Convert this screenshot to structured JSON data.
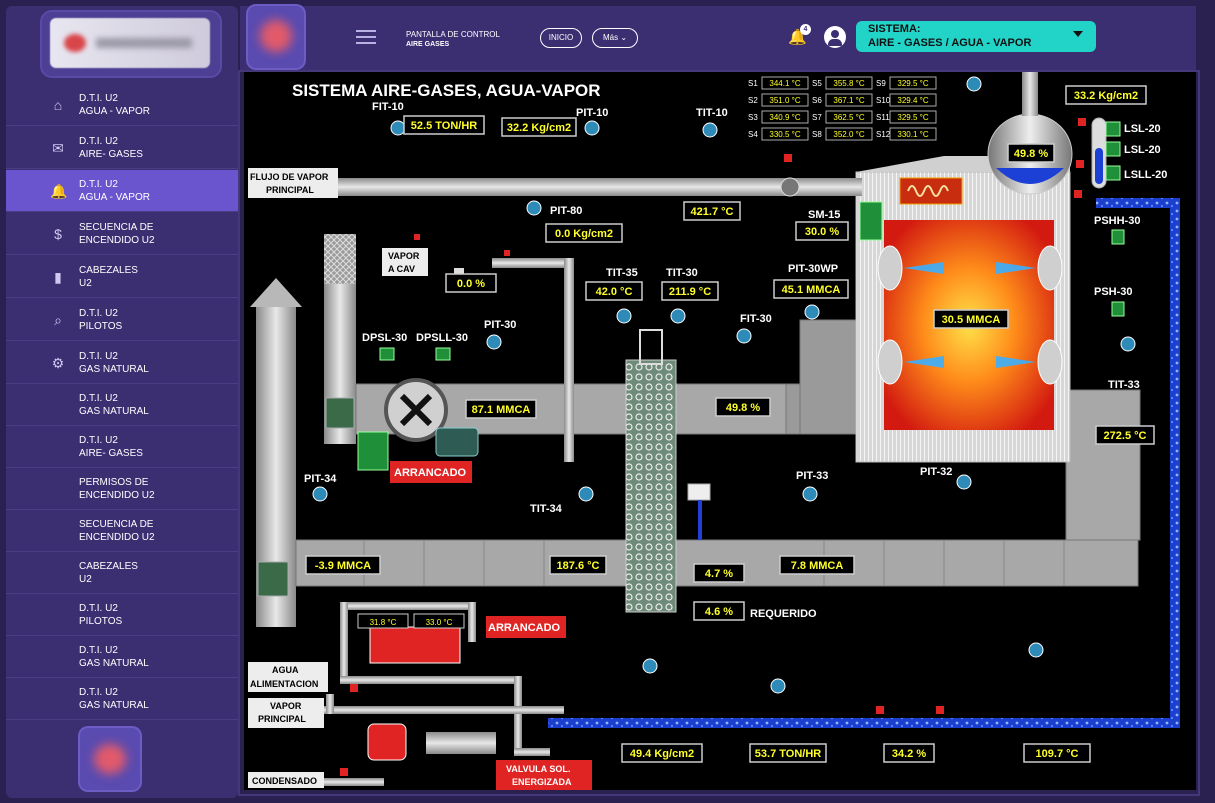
{
  "sidebar": {
    "items": [
      {
        "icon": "bank-icon",
        "l1": "D.T.I. U2",
        "l2": "AGUA - VAPOR"
      },
      {
        "icon": "mail-icon",
        "l1": "D.T.I. U2",
        "l2": "AIRE- GASES"
      },
      {
        "icon": "bell-icon",
        "l1": "D.T.I. U2",
        "l2": "AGUA - VAPOR"
      },
      {
        "icon": "dollar-icon",
        "l1": "SECUENCIA DE",
        "l2": "ENCENDIDO U2"
      },
      {
        "icon": "chart-icon",
        "l1": "CABEZALES",
        "l2": "U2"
      },
      {
        "icon": "search-icon",
        "l1": "D.T.I. U2",
        "l2": "PILOTOS"
      },
      {
        "icon": "gear-icon",
        "l1": "D.T.I. U2",
        "l2": "GAS NATURAL"
      },
      {
        "icon": "",
        "l1": "D.T.I. U2",
        "l2": "GAS NATURAL"
      },
      {
        "icon": "",
        "l1": "D.T.I. U2",
        "l2": "AIRE- GASES"
      },
      {
        "icon": "",
        "l1": "PERMISOS DE",
        "l2": "ENCENDIDO U2"
      },
      {
        "icon": "",
        "l1": "SECUENCIA DE",
        "l2": "ENCENDIDO U2"
      },
      {
        "icon": "",
        "l1": "CABEZALES",
        "l2": "U2"
      },
      {
        "icon": "",
        "l1": "D.T.I. U2",
        "l2": "PILOTOS"
      },
      {
        "icon": "",
        "l1": "D.T.I. U2",
        "l2": "GAS NATURAL"
      },
      {
        "icon": "",
        "l1": "D.T.I. U2",
        "l2": "GAS NATURAL"
      }
    ]
  },
  "topbar": {
    "title1": "PANTALLA DE CONTROL",
    "title2": "AIRE GASES",
    "inicio": "INICIO",
    "mas": "Más",
    "notifications": "4",
    "system_label": "SISTEMA:",
    "system_value": "AIRE - GASES / AGUA - VAPOR"
  },
  "scada": {
    "title": "SISTEMA  AIRE-GASES, AGUA-VAPOR",
    "tags": {
      "fit10": "FIT-10",
      "pit10": "PIT-10",
      "tit10": "TIT-10",
      "pit80": "PIT-80",
      "sm15": "SM-15",
      "tit35": "TIT-35",
      "tit30": "TIT-30",
      "pit30wp": "PIT-30WP",
      "fit30": "FIT-30",
      "pit30": "PIT-30",
      "dpsl30": "DPSL-30",
      "dpsll30": "DPSLL-30",
      "pit34": "PIT-34",
      "tit34": "TIT-34",
      "pit33": "PIT-33",
      "pit32": "PIT-32",
      "tit33": "TIT-33",
      "psh30": "PSH-30",
      "pshh30": "PSHH-30",
      "lsl20a": "LSL-20",
      "lsl20b": "LSL-20",
      "lsll20": "LSLL-20"
    },
    "labels": {
      "flujo1": "FLUJO DE VAPOR",
      "flujo2": "PRINCIPAL",
      "vapor_cav1": "VAPOR",
      "vapor_cav2": "A CAV",
      "agua1": "AGUA",
      "agua2": "ALIMENTACION",
      "vapor_p1": "VAPOR",
      "vapor_p2": "PRINCIPAL",
      "condensado": "CONDENSADO",
      "requerido": "REQUERIDO",
      "arrancado1": "ARRANCADO",
      "arrancado2": "ARRANCADO",
      "valvula1": "VALVULA SOL.",
      "valvula2": "ENERGIZADA"
    },
    "values": {
      "fit10": "52.5 TON/HR",
      "pit10": "32.2 Kg/cm2",
      "tit10": "421.7 °C",
      "pit80": "0.0 Kg/cm2",
      "sm15": "30.0 %",
      "vapor_cav": "0.0 %",
      "tit35": "42.0 °C",
      "tit30": "211.9 °C",
      "pit30wp": "45.1 MMCA",
      "furnace": "30.5 MMCA",
      "pit30": "87.1 MMCA",
      "fit30": "49.8 %",
      "tit33": "272.5 °C",
      "pit34": "-3.9 MMCA",
      "tit34": "187.6 °C",
      "o2": "4.7 %",
      "o2_req": "4.6 %",
      "pit33": "7.8 MMCA",
      "drum_level": "49.8 %",
      "drum_press": "33.2 Kg/cm2",
      "pump_t1": "31.8 °C",
      "pump_t2": "33.0 °C",
      "feed_press": "49.4 Kg/cm2",
      "feed_flow": "53.7 TON/HR",
      "feed_valve": "34.2 %",
      "feed_temp": "109.7 °C"
    },
    "sensors": [
      {
        "id": "S1",
        "v": "344.1 °C"
      },
      {
        "id": "S5",
        "v": "355.8 °C"
      },
      {
        "id": "S9",
        "v": "329.5 °C"
      },
      {
        "id": "S2",
        "v": "351.0 °C"
      },
      {
        "id": "S6",
        "v": "367.1 °C"
      },
      {
        "id": "S10",
        "v": "329.4 °C"
      },
      {
        "id": "S3",
        "v": "340.9 °C"
      },
      {
        "id": "S7",
        "v": "362.5 °C"
      },
      {
        "id": "S11",
        "v": "329.5 °C"
      },
      {
        "id": "S4",
        "v": "330.5 °C"
      },
      {
        "id": "S8",
        "v": "352.0 °C"
      },
      {
        "id": "S12",
        "v": "330.1 °C"
      }
    ]
  }
}
